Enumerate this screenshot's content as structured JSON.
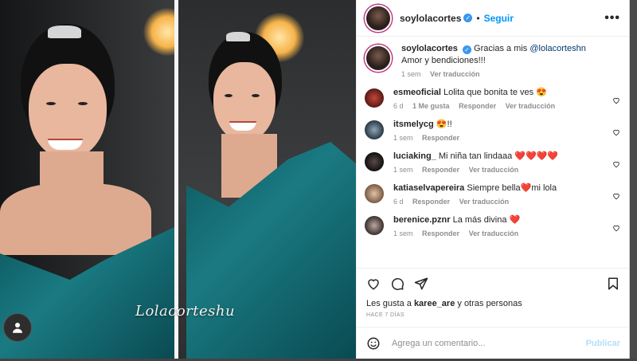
{
  "post": {
    "author": "soylolacortes",
    "follow_label": "Seguir",
    "more_label": "•••",
    "watermark": "Lolacorteshu"
  },
  "caption": {
    "user": "soylolacortes",
    "text_before": "Gracias a mis ",
    "mention": "@lolacorteshn",
    "text_after": " Amor y bendiciones!!!",
    "time": "1 sem",
    "translate": "Ver traducción"
  },
  "comments": [
    {
      "user": "esmeoficial",
      "text": "Lolita que bonita te ves 😍",
      "time": "6 d",
      "likes": "1 Me gusta",
      "reply": "Responder",
      "translate": "Ver traducción"
    },
    {
      "user": "itsmelycg",
      "text": "😍!!",
      "time": "1 sem",
      "likes": "",
      "reply": "Responder",
      "translate": ""
    },
    {
      "user": "luciaking_",
      "text": "Mi niña tan lindaaa ❤️❤️❤️❤️",
      "time": "1 sem",
      "likes": "",
      "reply": "Responder",
      "translate": "Ver traducción"
    },
    {
      "user": "katiaselvapereira",
      "text": "Siempre bella❤️mi lola",
      "time": "6 d",
      "likes": "",
      "reply": "Responder",
      "translate": "Ver traducción"
    },
    {
      "user": "berenice.pznr",
      "text": "La más divina ❤️",
      "time": "1 sem",
      "likes": "",
      "reply": "Responder",
      "translate": "Ver traducción"
    }
  ],
  "likes": {
    "prefix": "Les gusta a ",
    "user": "karee_are",
    "suffix": " y otras personas"
  },
  "posted_ago": "HACE 7 DÍAS",
  "add_comment": {
    "placeholder": "Agrega un comentario...",
    "publish_label": "Publicar"
  },
  "colors": {
    "accent": "#0095f6",
    "verified": "#3897f0",
    "heart": "#ed4956"
  }
}
